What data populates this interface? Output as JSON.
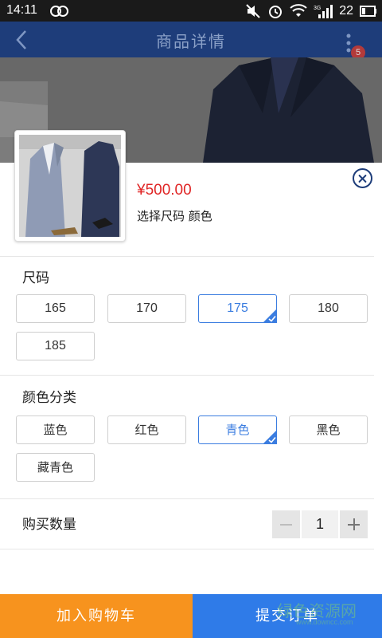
{
  "status_bar": {
    "time": "14:11",
    "battery_level": "22",
    "network_type": "3G"
  },
  "header": {
    "title": "商品详情",
    "cart_badge": "5"
  },
  "product": {
    "price": "¥500.00",
    "select_hint": "选择尺码  颜色"
  },
  "size_section": {
    "title": "尺码",
    "options": [
      "165",
      "170",
      "175",
      "180",
      "185"
    ],
    "selected": "175"
  },
  "color_section": {
    "title": "颜色分类",
    "options": [
      "蓝色",
      "红色",
      "青色",
      "黑色",
      "藏青色"
    ],
    "selected": "青色"
  },
  "quantity": {
    "label": "购买数量",
    "value": "1"
  },
  "actions": {
    "add_to_cart": "加入购物车",
    "submit_order": "提交订单"
  },
  "watermark": {
    "text": "绿色资源网",
    "sub": "www.downcc.com"
  },
  "colors": {
    "accent_blue": "#3b7de0",
    "price_red": "#e02525",
    "cart_orange": "#f7931e",
    "order_blue": "#2f7be8",
    "header_navy": "#1e3d7a"
  }
}
